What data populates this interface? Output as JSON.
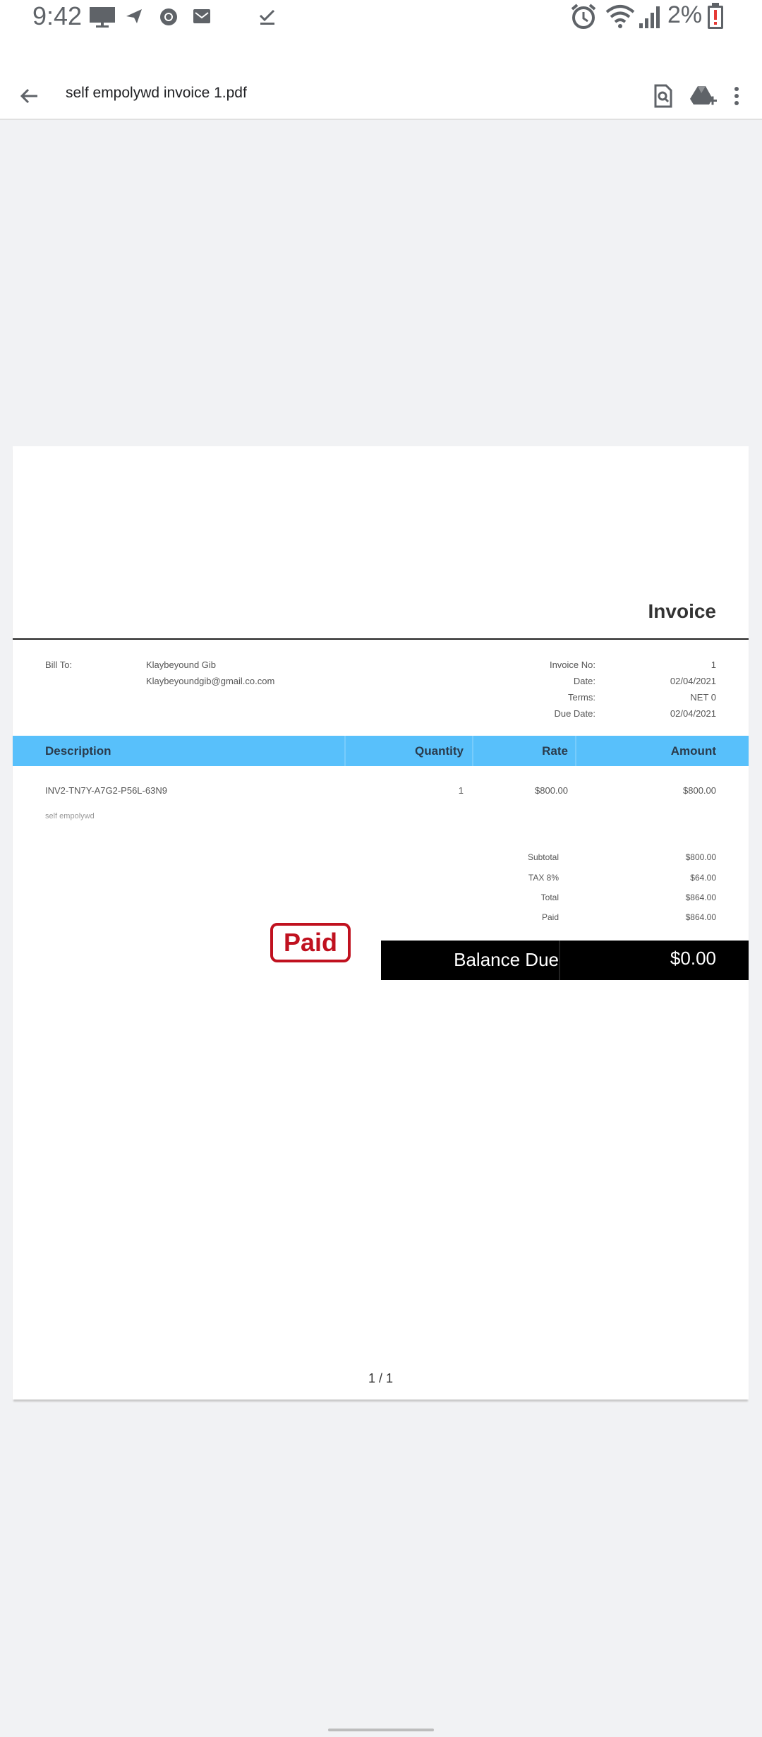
{
  "status_bar": {
    "time": "9:42",
    "battery": "2%",
    "icons_left": [
      "monitor-icon",
      "send-icon",
      "chrome-icon",
      "mail-icon",
      "check-icon"
    ],
    "icons_right": [
      "alarm-icon",
      "wifi-icon",
      "signal-icon",
      "battery-alert-icon"
    ]
  },
  "app_bar": {
    "title": "self empolywd invoice 1.pdf",
    "actions": [
      "search-document-icon",
      "add-to-drive-icon",
      "more-vert-icon"
    ]
  },
  "invoice": {
    "heading": "Invoice",
    "bill_to_label": "Bill To:",
    "bill_to_name": "Klaybeyound Gib",
    "bill_to_email": "Klaybeyoundgib@gmail.co.com",
    "meta": [
      {
        "label": "Invoice No:",
        "value": "1"
      },
      {
        "label": "Date:",
        "value": "02/04/2021"
      },
      {
        "label": "Terms:",
        "value": "NET 0"
      },
      {
        "label": "Due Date:",
        "value": "02/04/2021"
      }
    ],
    "table": {
      "headers": [
        "Description",
        "Quantity",
        "Rate",
        "Amount"
      ],
      "rows": [
        {
          "description": "INV2-TN7Y-A7G2-P56L-63N9",
          "quantity": "1",
          "rate": "$800.00",
          "amount": "$800.00"
        }
      ],
      "note": "self empolywd"
    },
    "totals": [
      {
        "label": "Subtotal",
        "value": "$800.00"
      },
      {
        "label": "TAX 8%",
        "value": "$64.00"
      },
      {
        "label": "Total",
        "value": "$864.00"
      },
      {
        "label": "Paid",
        "value": "$864.00"
      }
    ],
    "paid_stamp": "Paid",
    "balance_due_label": "Balance Due",
    "balance_due_value": "$0.00",
    "colors": {
      "header": "#58c0fb",
      "stamp": "#c0111f",
      "balance_bg": "#000000"
    }
  },
  "page_indicator": "1 / 1"
}
